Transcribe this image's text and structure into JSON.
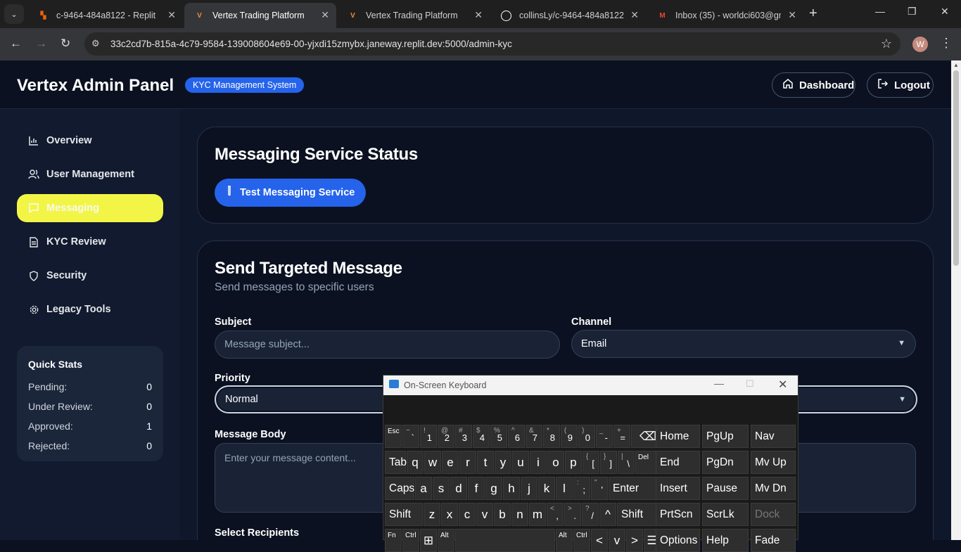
{
  "browser": {
    "tabs": [
      {
        "title": "c-9464-484a8122 - Replit",
        "favicon": "replit-icon"
      },
      {
        "title": "Vertex Trading Platform",
        "favicon": "vertex-icon"
      },
      {
        "title": "Vertex Trading Platform",
        "favicon": "vertex-icon"
      },
      {
        "title": "collinsLy/c-9464-484a8122",
        "favicon": "github-icon"
      },
      {
        "title": "Inbox (35) - worldci603@gm",
        "favicon": "gmail-icon"
      }
    ],
    "url": "33c2cd7b-815a-4c79-9584-139008604e69-00-yjxdi15zmybx.janeway.replit.dev:5000/admin-kyc",
    "profile_initial": "W"
  },
  "header": {
    "title": "Vertex Admin Panel",
    "badge": "KYC Management System",
    "dashboard_label": "Dashboard",
    "logout_label": "Logout"
  },
  "sidebar": {
    "items": [
      {
        "label": "Overview",
        "icon": "bar-chart-icon"
      },
      {
        "label": "User Management",
        "icon": "users-icon"
      },
      {
        "label": "Messaging",
        "icon": "message-icon"
      },
      {
        "label": "KYC Review",
        "icon": "document-icon"
      },
      {
        "label": "Security",
        "icon": "shield-icon"
      },
      {
        "label": "Legacy Tools",
        "icon": "gear-icon"
      }
    ],
    "active_item": "Messaging",
    "stats": {
      "title": "Quick Stats",
      "rows": [
        {
          "label": "Pending:",
          "value": "0"
        },
        {
          "label": "Under Review:",
          "value": "0"
        },
        {
          "label": "Approved:",
          "value": "1"
        },
        {
          "label": "Rejected:",
          "value": "0"
        }
      ]
    }
  },
  "status_card": {
    "title": "Messaging Service Status",
    "test_button": "Test Messaging Service"
  },
  "message_card": {
    "title": "Send Targeted Message",
    "subtitle": "Send messages to specific users",
    "subject_label": "Subject",
    "subject_placeholder": "Message subject...",
    "channel_label": "Channel",
    "channel_value": "Email",
    "priority_label": "Priority",
    "priority_value": "Normal",
    "body_label": "Message Body",
    "body_placeholder": "Enter your message content...",
    "recipients_label": "Select Recipients"
  },
  "osk": {
    "title": "On-Screen Keyboard",
    "rows": [
      [
        {
          "main": "Esc"
        },
        {
          "main": "`",
          "alt": "~"
        },
        {
          "main": "1",
          "alt": "!"
        },
        {
          "main": "2",
          "alt": "@"
        },
        {
          "main": "3",
          "alt": "#"
        },
        {
          "main": "4",
          "alt": "$"
        },
        {
          "main": "5",
          "alt": "%"
        },
        {
          "main": "6",
          "alt": "^"
        },
        {
          "main": "7",
          "alt": "&"
        },
        {
          "main": "8",
          "alt": "*"
        },
        {
          "main": "9",
          "alt": "("
        },
        {
          "main": "0",
          "alt": ")"
        },
        {
          "main": "-",
          "alt": "_"
        },
        {
          "main": "=",
          "alt": "+"
        },
        {
          "main": "⌫"
        }
      ],
      [
        {
          "main": "Tab"
        },
        {
          "main": "q"
        },
        {
          "main": "w"
        },
        {
          "main": "e"
        },
        {
          "main": "r"
        },
        {
          "main": "t"
        },
        {
          "main": "y"
        },
        {
          "main": "u"
        },
        {
          "main": "i"
        },
        {
          "main": "o"
        },
        {
          "main": "p"
        },
        {
          "main": "[",
          "alt": "{"
        },
        {
          "main": "]",
          "alt": "}"
        },
        {
          "main": "\\",
          "alt": "|"
        },
        {
          "main": "Del"
        }
      ],
      [
        {
          "main": "Caps"
        },
        {
          "main": "a"
        },
        {
          "main": "s"
        },
        {
          "main": "d"
        },
        {
          "main": "f"
        },
        {
          "main": "g"
        },
        {
          "main": "h"
        },
        {
          "main": "j"
        },
        {
          "main": "k"
        },
        {
          "main": "l"
        },
        {
          "main": ";",
          "alt": ":"
        },
        {
          "main": "'",
          "alt": "\""
        },
        {
          "main": "Enter"
        }
      ],
      [
        {
          "main": "Shift"
        },
        {
          "main": "z"
        },
        {
          "main": "x"
        },
        {
          "main": "c"
        },
        {
          "main": "v"
        },
        {
          "main": "b"
        },
        {
          "main": "n"
        },
        {
          "main": "m"
        },
        {
          "main": ",",
          "alt": "<"
        },
        {
          "main": ".",
          "alt": ">"
        },
        {
          "main": "/",
          "alt": "?"
        },
        {
          "main": "^"
        },
        {
          "main": "Shift"
        }
      ],
      [
        {
          "main": "Fn"
        },
        {
          "main": "Ctrl"
        },
        {
          "main": "⊞"
        },
        {
          "main": "Alt"
        },
        {
          "main": ""
        },
        {
          "main": "Alt"
        },
        {
          "main": "Ctrl"
        },
        {
          "main": "<"
        },
        {
          "main": "v"
        },
        {
          "main": ">"
        },
        {
          "main": "☰"
        }
      ]
    ],
    "nav_keys": [
      [
        "Home",
        "PgUp",
        "Nav"
      ],
      [
        "End",
        "PgDn",
        "Mv Up"
      ],
      [
        "Insert",
        "Pause",
        "Mv Dn"
      ],
      [
        "PrtScn",
        "ScrLk",
        "Dock"
      ],
      [
        "Options",
        "Help",
        "Fade"
      ]
    ]
  }
}
